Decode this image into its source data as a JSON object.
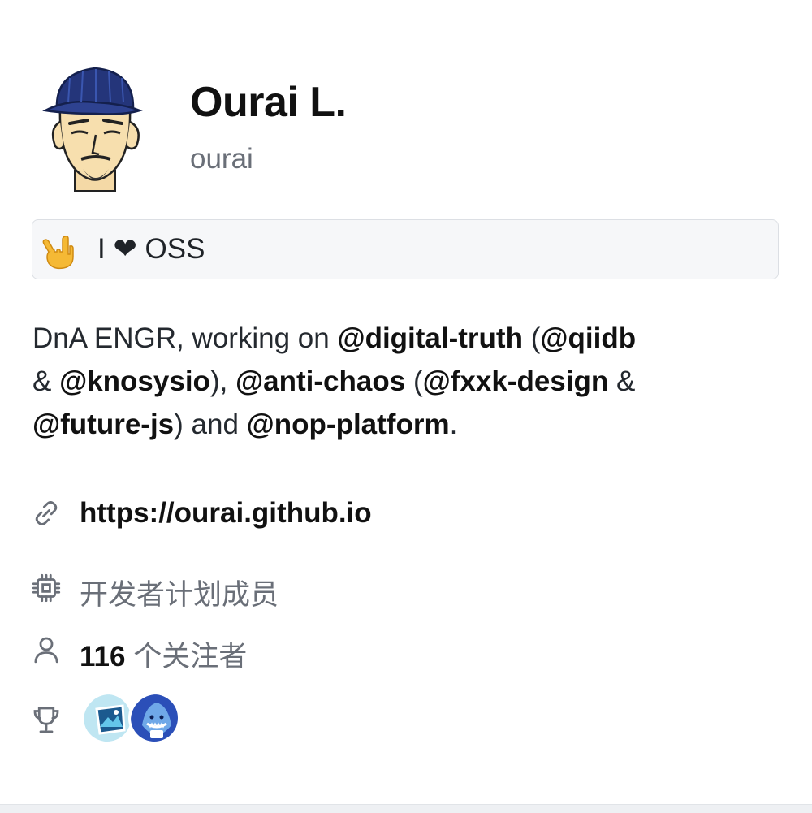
{
  "profile": {
    "name": "Ourai L.",
    "login": "ourai"
  },
  "status": {
    "emoji": "love-you-gesture-icon",
    "text": "I ❤ OSS"
  },
  "bio": {
    "p1": "DnA ENGR, working on ",
    "m1": "@digital-truth",
    "p2": " (",
    "m2": "@qiidb",
    "p3": " & ",
    "m3": "@knosysio",
    "p4": "), ",
    "m4": "@anti-chaos",
    "p5": " (",
    "m5": "@fxxk-design",
    "p6": " & ",
    "m6": "@future-js",
    "p7": ") and ",
    "m7": "@nop-platform",
    "p8": "."
  },
  "details": {
    "website": "https://ourai.github.io",
    "program": "开发者计划成员",
    "followers_count": "116",
    "followers_label": " 个关注者"
  },
  "achievements": [
    "achievement-badge-1-icon",
    "achievement-badge-2-icon"
  ],
  "colors": {
    "text": "#1f2328",
    "muted": "#6a6f78",
    "status_bg": "#f6f7f9",
    "status_border": "#dcdfe4",
    "avatar_hat": "#24357a"
  }
}
